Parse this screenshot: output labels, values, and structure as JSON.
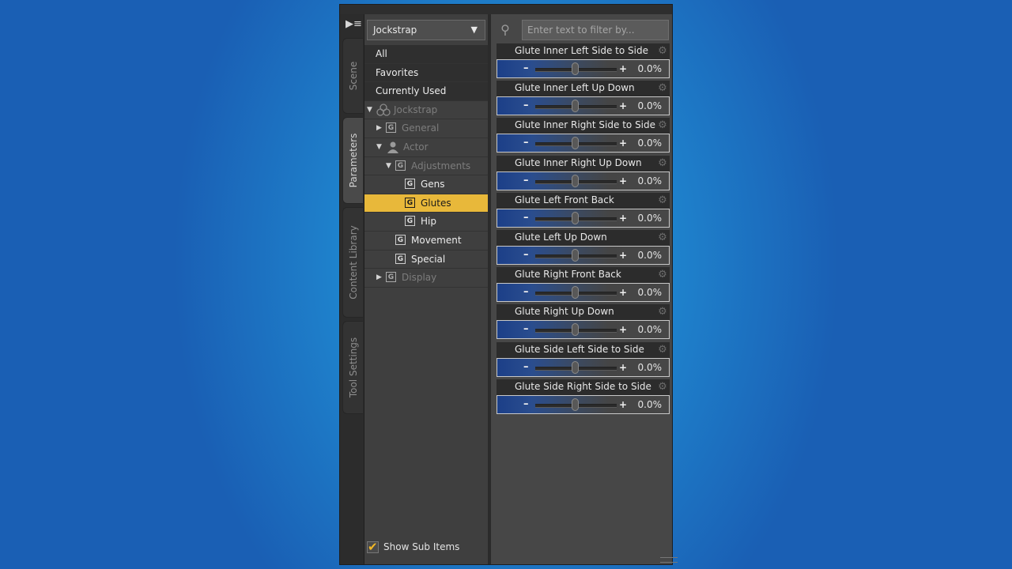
{
  "tabs": [
    {
      "label": "Scene",
      "active": false
    },
    {
      "label": "Parameters",
      "active": true
    },
    {
      "label": "Content Library",
      "active": false
    },
    {
      "label": "Tool Settings",
      "active": false
    }
  ],
  "node_dropdown": {
    "value": "Jockstrap"
  },
  "tree": {
    "flat": [
      "All",
      "Favorites",
      "Currently Used"
    ],
    "nodes": [
      {
        "label": "Jockstrap",
        "depth": 0,
        "toggle": "expanded",
        "icon": "figure-icon",
        "dim": true
      },
      {
        "label": "General",
        "depth": 1,
        "toggle": "collapsed",
        "icon": "group-icon",
        "dim": true
      },
      {
        "label": "Actor",
        "depth": 1,
        "toggle": "expanded",
        "icon": "actor-icon",
        "dim": true
      },
      {
        "label": "Adjustments",
        "depth": 2,
        "toggle": "expanded",
        "icon": "group-icon",
        "dim": true
      },
      {
        "label": "Gens",
        "depth": 3,
        "toggle": "none",
        "icon": "group-icon",
        "dim": false
      },
      {
        "label": "Glutes",
        "depth": 3,
        "toggle": "none",
        "icon": "group-icon",
        "dim": false,
        "selected": true
      },
      {
        "label": "Hip",
        "depth": 3,
        "toggle": "none",
        "icon": "group-icon",
        "dim": false
      },
      {
        "label": "Movement",
        "depth": 2,
        "toggle": "none",
        "icon": "group-icon",
        "dim": false
      },
      {
        "label": "Special",
        "depth": 2,
        "toggle": "none",
        "icon": "group-icon",
        "dim": false
      },
      {
        "label": "Display",
        "depth": 1,
        "toggle": "collapsed",
        "icon": "group-icon",
        "dim": true
      }
    ]
  },
  "group_icon_glyph": "G",
  "show_sub_items": {
    "label": "Show Sub Items",
    "checked": true
  },
  "filter": {
    "placeholder": "Enter text to filter by..."
  },
  "sliders": [
    {
      "name": "Glute Inner Left Side to Side",
      "value": "0.0%"
    },
    {
      "name": "Glute Inner Left Up Down",
      "value": "0.0%"
    },
    {
      "name": "Glute Inner Right Side to Side",
      "value": "0.0%"
    },
    {
      "name": "Glute Inner Right Up Down",
      "value": "0.0%"
    },
    {
      "name": "Glute Left Front Back",
      "value": "0.0%"
    },
    {
      "name": "Glute Left Up Down",
      "value": "0.0%"
    },
    {
      "name": "Glute Right Front Back",
      "value": "0.0%"
    },
    {
      "name": "Glute Right Up Down",
      "value": "0.0%"
    },
    {
      "name": "Glute Side Left Side to Side",
      "value": "0.0%"
    },
    {
      "name": "Glute Side Right Side to Side",
      "value": "0.0%"
    }
  ],
  "colors": {
    "selection": "#e8b83a",
    "check": "#f1b727",
    "slider_fill": "#1c3f88"
  }
}
